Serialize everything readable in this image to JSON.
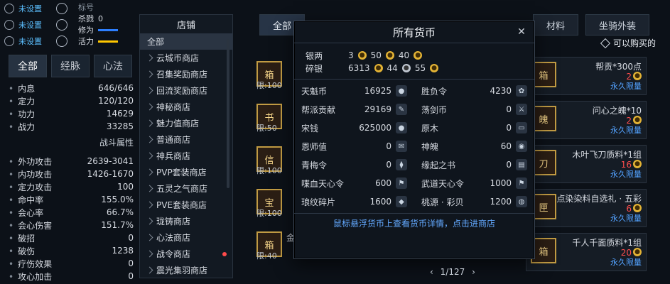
{
  "left_top": {
    "rows": [
      {
        "status": "未设置"
      },
      {
        "status": "未设置"
      },
      {
        "status": "未设置"
      }
    ],
    "mini_stats": [
      {
        "label": "标号",
        "value": ""
      },
      {
        "label": "杀戮",
        "value": "0"
      },
      {
        "label": "修为",
        "value": ""
      },
      {
        "label": "活力",
        "value": ""
      }
    ]
  },
  "left_tabs": [
    "全部",
    "经脉",
    "心法"
  ],
  "stats": [
    {
      "name": "内息",
      "value": "646/646"
    },
    {
      "name": "定力",
      "value": "120/120"
    },
    {
      "name": "功力",
      "value": "14629"
    },
    {
      "name": "战力",
      "value": "33285"
    }
  ],
  "combat_section_title": "战斗属性",
  "combat_stats": [
    {
      "name": "外功攻击",
      "value": "2639-3041"
    },
    {
      "name": "内功攻击",
      "value": "1426-1670"
    },
    {
      "name": "定力攻击",
      "value": "100"
    },
    {
      "name": "命中率",
      "value": "155.0%"
    },
    {
      "name": "会心率",
      "value": "66.7%"
    },
    {
      "name": "会心伤害",
      "value": "151.7%"
    },
    {
      "name": "破招",
      "value": "0"
    },
    {
      "name": "破伤",
      "value": "1238"
    },
    {
      "name": "疗伤效果",
      "value": "0"
    },
    {
      "name": "攻心加击",
      "value": "0"
    }
  ],
  "shop_list": {
    "title": "店铺",
    "items": [
      {
        "label": "全部",
        "selected": true
      },
      {
        "label": "云城币商店"
      },
      {
        "label": "召集奖励商店"
      },
      {
        "label": "回流奖励商店"
      },
      {
        "label": "神秘商店"
      },
      {
        "label": "魅力值商店"
      },
      {
        "label": "普通商店"
      },
      {
        "label": "神兵商店"
      },
      {
        "label": "PVP套装商店"
      },
      {
        "label": "五灵之气商店"
      },
      {
        "label": "PVE套装商店"
      },
      {
        "label": "珑铸商店"
      },
      {
        "label": "心法商店"
      },
      {
        "label": "战令商店",
        "dot": true
      },
      {
        "label": "震光集羽商店"
      }
    ]
  },
  "top_tabs": [
    "全部",
    "材料",
    "坐骑外装"
  ],
  "filter_label": "可以购买的",
  "right_cards": [
    {
      "name": "帮贡*300点",
      "cost": "2",
      "cost_color": "#ff4d4d",
      "permanent": "永久限量",
      "limit": "限:100"
    },
    {
      "name": "问心之魄*10",
      "cost": "2",
      "cost_color": "#ff4d4d",
      "permanent": "永久限量",
      "limit": "限:50"
    },
    {
      "name": "木叶飞刀质料*1组",
      "cost": "16",
      "cost_color": "#ff4d4d",
      "permanent": "永久限量",
      "limit": "限:100"
    },
    {
      "name": "点染染料自选礼 · 五彩",
      "cost": "6",
      "cost_color": "#ff4d4d",
      "permanent": "永久限量",
      "limit": "限:100"
    },
    {
      "name": "千人千面质料*1组",
      "cost": "20",
      "cost_color": "#ff4d4d",
      "permanent": "永久限量",
      "limit": "限:40"
    }
  ],
  "left_cards_labels": [
    "限:100",
    "限:50",
    "限:100",
    "限:100",
    "限:40"
  ],
  "left_bottom_label": "金",
  "modal": {
    "title": "所有货币",
    "silver": {
      "label": "银两",
      "values": [
        "3",
        "50",
        "40"
      ]
    },
    "broken_silver": {
      "label": "碎银",
      "values": [
        "6313",
        "44",
        "55"
      ]
    },
    "currencies": [
      {
        "name": "天魁币",
        "value": "16925",
        "icon": "coin"
      },
      {
        "name": "胜负令",
        "value": "4230",
        "icon": "leaf"
      },
      {
        "name": "帮派贡献",
        "value": "29169",
        "icon": "feather"
      },
      {
        "name": "荡剑币",
        "value": "0",
        "icon": "sword"
      },
      {
        "name": "宋钱",
        "value": "625000",
        "icon": "coin"
      },
      {
        "name": "原木",
        "value": "0",
        "icon": "wood"
      },
      {
        "name": "恩师值",
        "value": "0",
        "icon": "book"
      },
      {
        "name": "神魄",
        "value": "60",
        "icon": "orb"
      },
      {
        "name": "青梅令",
        "value": "0",
        "icon": "bottle"
      },
      {
        "name": "缘起之书",
        "value": "0",
        "icon": "scroll"
      },
      {
        "name": "喋血天心令",
        "value": "600",
        "icon": "flag"
      },
      {
        "name": "武道天心令",
        "value": "1000",
        "icon": "flag"
      },
      {
        "name": "琅纹碎片",
        "value": "1600",
        "icon": "shard"
      },
      {
        "name": "桃源 · 彩贝",
        "value": "1200",
        "icon": "shell"
      }
    ],
    "footer": "鼠标悬浮货币上查看货币详情，点击进商店"
  },
  "pager": {
    "text": "1/127"
  }
}
